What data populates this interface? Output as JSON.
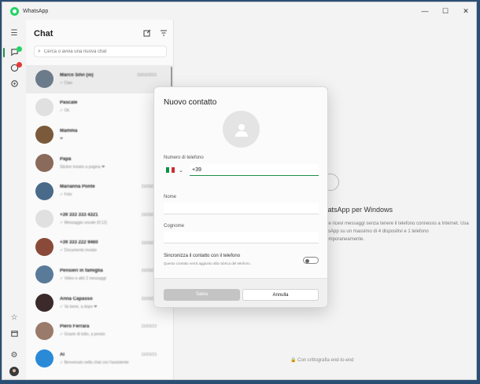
{
  "app": {
    "title": "WhatsApp"
  },
  "window_controls": {
    "minimize": "—",
    "maximize": "☐",
    "close": "✕"
  },
  "rail": {
    "icons": [
      "menu-icon",
      "chats-icon",
      "status-icon",
      "settings-gear-icon",
      "starred-icon",
      "archive-icon",
      "settings-icon",
      "profile-avatar"
    ]
  },
  "chat_panel": {
    "title": "Chat",
    "search_placeholder": "Cerca o avvia una nuova chat",
    "chats": [
      {
        "name": "Marco Silvi (io)",
        "preview": "✓ Ciao",
        "time": "15/03/2023",
        "color": "#6b7b8a"
      },
      {
        "name": "Pascale",
        "preview": "✓ Ok",
        "time": "",
        "color": "#e0e0e0"
      },
      {
        "name": "Mamma",
        "preview": "❤",
        "time": "",
        "color": "#7a5a3a"
      },
      {
        "name": "Papà",
        "preview": "Sticker inviato a pagina ❤",
        "time": "",
        "color": "#8a6a5a"
      },
      {
        "name": "Marianna Ponte",
        "preview": "✓ Foto",
        "time": "15/03/23",
        "color": "#4a6a8a"
      },
      {
        "name": "+39 333 333 4321",
        "preview": "✓ Messaggio vocale (0:12)",
        "time": "15/03/23",
        "color": "#e0e0e0"
      },
      {
        "name": "+39 333 222 9460",
        "preview": "✓ Documento inviato",
        "time": "15/03/23",
        "color": "#8a4a3a"
      },
      {
        "name": "Pensieri in famiglia",
        "preview": "✓ Video e altri 2 messaggi",
        "time": "15/03/23",
        "color": "#5a7a9a"
      },
      {
        "name": "Anna Capasso",
        "preview": "✓ Va bene, a dopo ❤",
        "time": "15/03/23",
        "color": "#3a2a2a"
      },
      {
        "name": "Piero Ferrara",
        "preview": "✓ Grazie di tutto, a presto",
        "time": "15/03/23",
        "color": "#9a7a6a"
      },
      {
        "name": "AI",
        "preview": "✓ Benvenuto nella chat con l'assistente",
        "time": "15/03/23",
        "color": "#2a8ad8"
      }
    ]
  },
  "main": {
    "welcome_title": "WhatsApp per Windows",
    "welcome_desc": "Invia e ricevi messaggi senza tenere il telefono connesso a Internet. Usa WhatsApp su un massimo di 4 dispositivi e 1 telefono contemporaneamente.",
    "encrypted_note": "🔒 Con crittografia end-to-end"
  },
  "dialog": {
    "title": "Nuovo contatto",
    "phone_label": "Numero di telefono",
    "country_code": "+39",
    "first_name_label": "Nome",
    "last_name_label": "Cognome",
    "sync_title": "Sincronizza il contatto con il telefono",
    "sync_desc": "Questo contatto verrà aggiunto alla rubrica del telefono.",
    "save_label": "Salva",
    "cancel_label": "Annulla",
    "accent_color": "#1f8e4c"
  }
}
